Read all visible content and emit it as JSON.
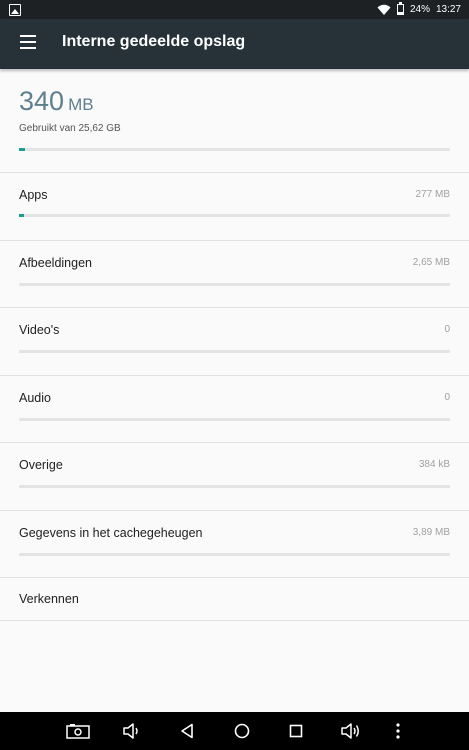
{
  "status_bar": {
    "battery": "24%",
    "time": "13:27",
    "battery_level": 0.24
  },
  "app_bar": {
    "title": "Interne gedeelde opslag"
  },
  "summary": {
    "used_value": "340",
    "used_unit": "MB",
    "total_text": "Gebruikt van 25,62 GB",
    "used_fraction": 0.013
  },
  "items": [
    {
      "label": "Apps",
      "value": "277 MB",
      "fraction": 0.011
    },
    {
      "label": "Afbeeldingen",
      "value": "2,65 MB",
      "fraction": 0
    },
    {
      "label": "Video's",
      "value": "0",
      "fraction": 0
    },
    {
      "label": "Audio",
      "value": "0",
      "fraction": 0
    },
    {
      "label": "Overige",
      "value": "384 kB",
      "fraction": 0
    },
    {
      "label": "Gegevens in het cachegeheugen",
      "value": "3,89 MB",
      "fraction": 0
    }
  ],
  "explore": {
    "label": "Verkennen"
  },
  "colors": {
    "accent": "#1a9e8f",
    "app_bar": "#263238",
    "status_bar": "#1d2124",
    "big_number": "#5e7f8e"
  },
  "icons": {
    "status": [
      "image-icon",
      "wifi-icon",
      "battery-icon"
    ],
    "nav": [
      "screenshot-icon",
      "volume-down-icon",
      "back-icon",
      "home-icon",
      "recents-icon",
      "volume-up-icon",
      "more-icon"
    ]
  }
}
